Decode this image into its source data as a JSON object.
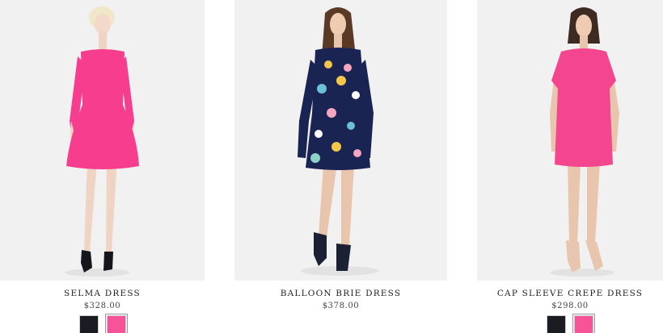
{
  "products": [
    {
      "name": "SELMA DRESS",
      "price": "$328.00",
      "dress_color": "#f73e8e",
      "swatches": [
        {
          "color": "#1b1c22",
          "label": "black"
        },
        {
          "color": "#f65399",
          "label": "pink"
        }
      ]
    },
    {
      "name": "BALLOON BRIE DRESS",
      "price": "$378.00",
      "dress_color": "#1a2452",
      "swatches": []
    },
    {
      "name": "CAP SLEEVE CREPE DRESS",
      "price": "$298.00",
      "dress_color": "#f4468f",
      "swatches": [
        {
          "color": "#1b1c22",
          "label": "black"
        },
        {
          "color": "#f65399",
          "label": "pink"
        }
      ]
    }
  ]
}
